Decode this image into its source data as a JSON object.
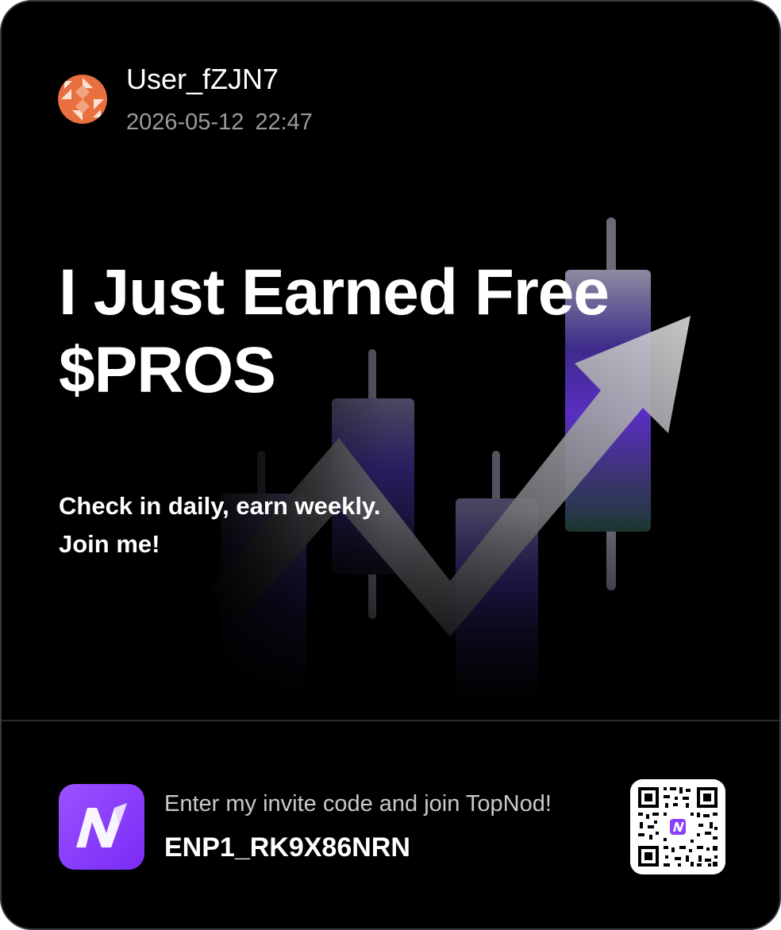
{
  "post": {
    "username": "User_fZJN7",
    "date": "2026-05-12",
    "time": "22:47",
    "avatar_icon": "geometric-avatar-icon"
  },
  "hero": {
    "headline_line1": "I Just Earned Free",
    "headline_line2": "$PROS",
    "subtext_line1": "Check in daily, earn weekly.",
    "subtext_line2": "Join me!",
    "illustration": "candlestick-chart-up-arrow-icon"
  },
  "footer": {
    "app_icon": "topnod-logo-icon",
    "invite_text": "Enter my invite code and join TopNod!",
    "invite_code": "ENP1_RK9X86NRN",
    "qr_icon": "qr-code-icon"
  },
  "colors": {
    "background": "#000000",
    "card_border": "#3a3a3c",
    "text_primary": "#ffffff",
    "text_secondary": "#9a9aa0",
    "avatar_orange": "#e8703f",
    "brand_purple": "#8a3ffc"
  }
}
